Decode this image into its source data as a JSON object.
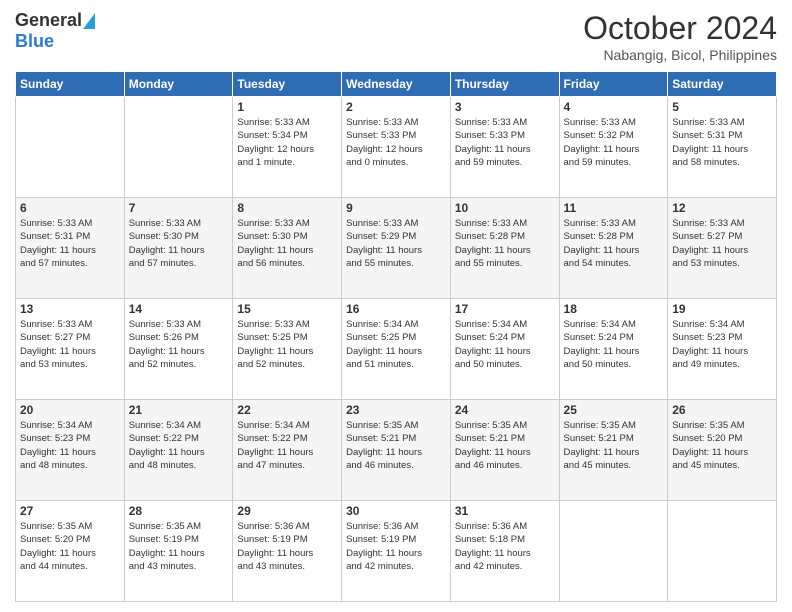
{
  "header": {
    "logo_general": "General",
    "logo_blue": "Blue",
    "month_title": "October 2024",
    "location": "Nabangig, Bicol, Philippines"
  },
  "days_of_week": [
    "Sunday",
    "Monday",
    "Tuesday",
    "Wednesday",
    "Thursday",
    "Friday",
    "Saturday"
  ],
  "weeks": [
    [
      {
        "day": "",
        "info": ""
      },
      {
        "day": "",
        "info": ""
      },
      {
        "day": "1",
        "info": "Sunrise: 5:33 AM\nSunset: 5:34 PM\nDaylight: 12 hours\nand 1 minute."
      },
      {
        "day": "2",
        "info": "Sunrise: 5:33 AM\nSunset: 5:33 PM\nDaylight: 12 hours\nand 0 minutes."
      },
      {
        "day": "3",
        "info": "Sunrise: 5:33 AM\nSunset: 5:33 PM\nDaylight: 11 hours\nand 59 minutes."
      },
      {
        "day": "4",
        "info": "Sunrise: 5:33 AM\nSunset: 5:32 PM\nDaylight: 11 hours\nand 59 minutes."
      },
      {
        "day": "5",
        "info": "Sunrise: 5:33 AM\nSunset: 5:31 PM\nDaylight: 11 hours\nand 58 minutes."
      }
    ],
    [
      {
        "day": "6",
        "info": "Sunrise: 5:33 AM\nSunset: 5:31 PM\nDaylight: 11 hours\nand 57 minutes."
      },
      {
        "day": "7",
        "info": "Sunrise: 5:33 AM\nSunset: 5:30 PM\nDaylight: 11 hours\nand 57 minutes."
      },
      {
        "day": "8",
        "info": "Sunrise: 5:33 AM\nSunset: 5:30 PM\nDaylight: 11 hours\nand 56 minutes."
      },
      {
        "day": "9",
        "info": "Sunrise: 5:33 AM\nSunset: 5:29 PM\nDaylight: 11 hours\nand 55 minutes."
      },
      {
        "day": "10",
        "info": "Sunrise: 5:33 AM\nSunset: 5:28 PM\nDaylight: 11 hours\nand 55 minutes."
      },
      {
        "day": "11",
        "info": "Sunrise: 5:33 AM\nSunset: 5:28 PM\nDaylight: 11 hours\nand 54 minutes."
      },
      {
        "day": "12",
        "info": "Sunrise: 5:33 AM\nSunset: 5:27 PM\nDaylight: 11 hours\nand 53 minutes."
      }
    ],
    [
      {
        "day": "13",
        "info": "Sunrise: 5:33 AM\nSunset: 5:27 PM\nDaylight: 11 hours\nand 53 minutes."
      },
      {
        "day": "14",
        "info": "Sunrise: 5:33 AM\nSunset: 5:26 PM\nDaylight: 11 hours\nand 52 minutes."
      },
      {
        "day": "15",
        "info": "Sunrise: 5:33 AM\nSunset: 5:25 PM\nDaylight: 11 hours\nand 52 minutes."
      },
      {
        "day": "16",
        "info": "Sunrise: 5:34 AM\nSunset: 5:25 PM\nDaylight: 11 hours\nand 51 minutes."
      },
      {
        "day": "17",
        "info": "Sunrise: 5:34 AM\nSunset: 5:24 PM\nDaylight: 11 hours\nand 50 minutes."
      },
      {
        "day": "18",
        "info": "Sunrise: 5:34 AM\nSunset: 5:24 PM\nDaylight: 11 hours\nand 50 minutes."
      },
      {
        "day": "19",
        "info": "Sunrise: 5:34 AM\nSunset: 5:23 PM\nDaylight: 11 hours\nand 49 minutes."
      }
    ],
    [
      {
        "day": "20",
        "info": "Sunrise: 5:34 AM\nSunset: 5:23 PM\nDaylight: 11 hours\nand 48 minutes."
      },
      {
        "day": "21",
        "info": "Sunrise: 5:34 AM\nSunset: 5:22 PM\nDaylight: 11 hours\nand 48 minutes."
      },
      {
        "day": "22",
        "info": "Sunrise: 5:34 AM\nSunset: 5:22 PM\nDaylight: 11 hours\nand 47 minutes."
      },
      {
        "day": "23",
        "info": "Sunrise: 5:35 AM\nSunset: 5:21 PM\nDaylight: 11 hours\nand 46 minutes."
      },
      {
        "day": "24",
        "info": "Sunrise: 5:35 AM\nSunset: 5:21 PM\nDaylight: 11 hours\nand 46 minutes."
      },
      {
        "day": "25",
        "info": "Sunrise: 5:35 AM\nSunset: 5:21 PM\nDaylight: 11 hours\nand 45 minutes."
      },
      {
        "day": "26",
        "info": "Sunrise: 5:35 AM\nSunset: 5:20 PM\nDaylight: 11 hours\nand 45 minutes."
      }
    ],
    [
      {
        "day": "27",
        "info": "Sunrise: 5:35 AM\nSunset: 5:20 PM\nDaylight: 11 hours\nand 44 minutes."
      },
      {
        "day": "28",
        "info": "Sunrise: 5:35 AM\nSunset: 5:19 PM\nDaylight: 11 hours\nand 43 minutes."
      },
      {
        "day": "29",
        "info": "Sunrise: 5:36 AM\nSunset: 5:19 PM\nDaylight: 11 hours\nand 43 minutes."
      },
      {
        "day": "30",
        "info": "Sunrise: 5:36 AM\nSunset: 5:19 PM\nDaylight: 11 hours\nand 42 minutes."
      },
      {
        "day": "31",
        "info": "Sunrise: 5:36 AM\nSunset: 5:18 PM\nDaylight: 11 hours\nand 42 minutes."
      },
      {
        "day": "",
        "info": ""
      },
      {
        "day": "",
        "info": ""
      }
    ]
  ]
}
